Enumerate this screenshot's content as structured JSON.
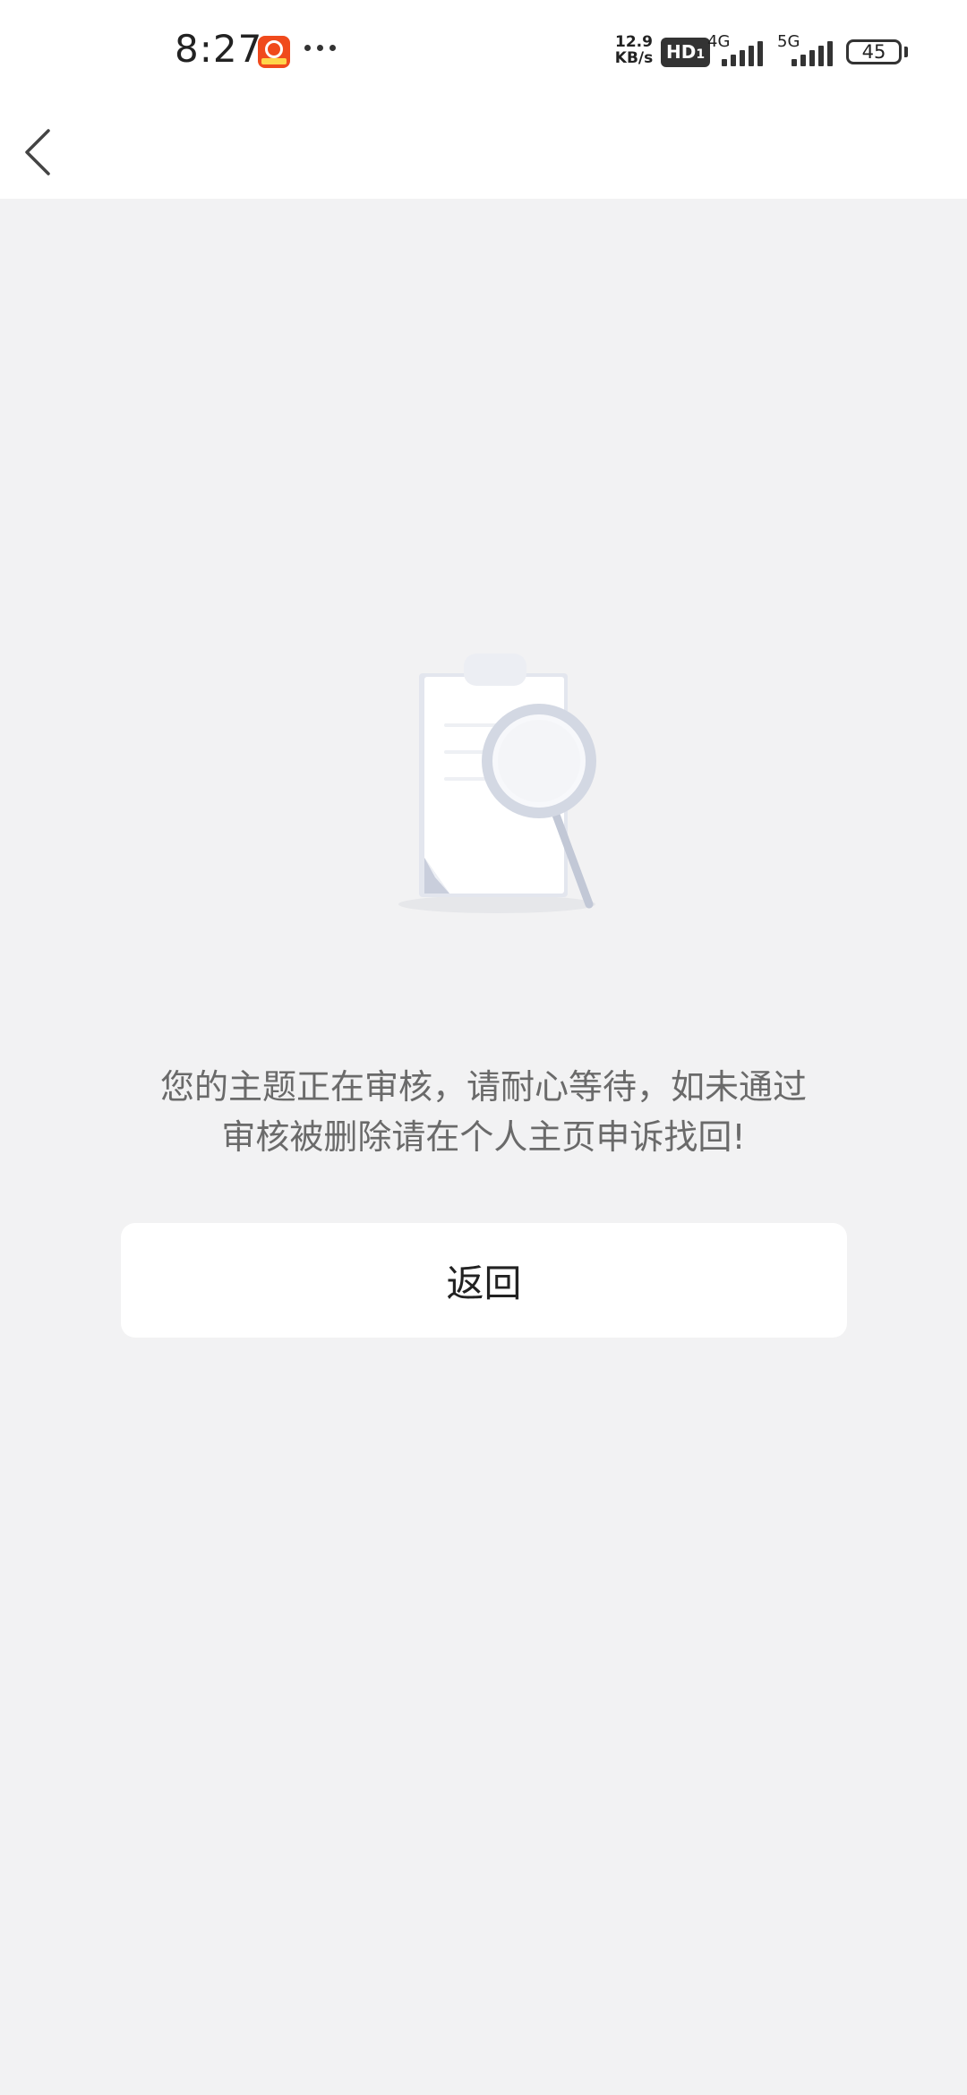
{
  "status_bar": {
    "time": "8:27",
    "net_speed_value": "12.9",
    "net_speed_unit": "KB/s",
    "hd_badge": "HD",
    "hd_sub": "1",
    "sim1_label": "4G",
    "sim2_label": "5G",
    "battery_level": "45",
    "icons": [
      "app-notification-icon",
      "more-dots-icon",
      "signal-4g-icon",
      "signal-5g-icon",
      "battery-icon"
    ]
  },
  "navbar": {
    "back_icon": "chevron-left-icon"
  },
  "content": {
    "illustration": "document-search-icon",
    "message_line1": "您的主题正在审核，请耐心等待，如未通过",
    "message_line2": "审核被删除请在个人主页申诉找回!",
    "button_label": "返回"
  },
  "colors": {
    "background": "#f2f2f3",
    "surface": "#ffffff",
    "text_secondary": "#6a6a6a",
    "text_primary": "#222222"
  }
}
